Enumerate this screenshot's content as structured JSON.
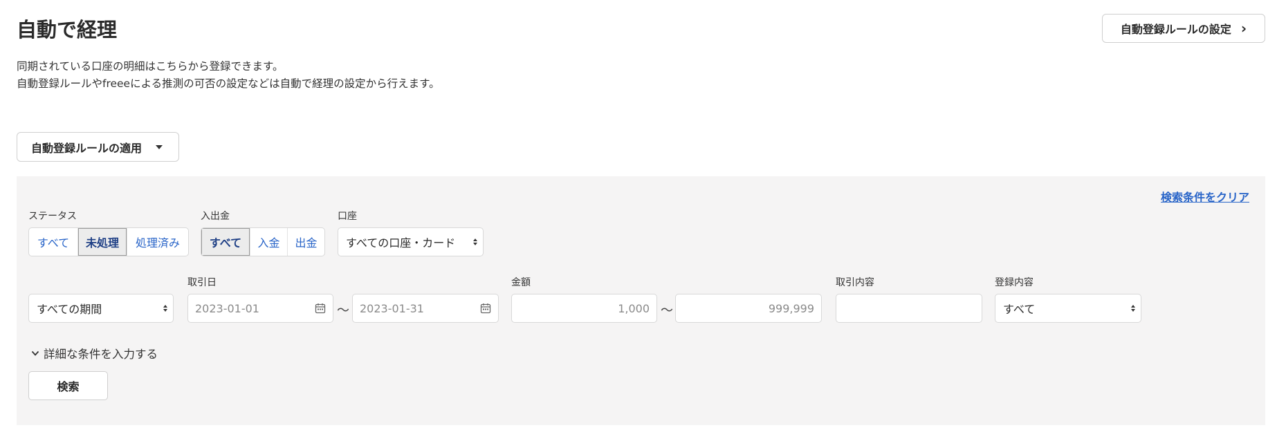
{
  "header": {
    "title": "自動で経理",
    "settings_button": "自動登録ルールの設定"
  },
  "description": [
    "同期されている口座の明細はこちらから登録できます。",
    "自動登録ルールやfreeeによる推測の可否の設定などは自動で経理の設定から行えます。"
  ],
  "apply_button": "自動登録ルールの適用",
  "filters": {
    "clear_link": "検索条件をクリア",
    "status": {
      "label": "ステータス",
      "options": [
        "すべて",
        "未処理",
        "処理済み"
      ],
      "selected": "未処理"
    },
    "inout": {
      "label": "入出金",
      "options": [
        "すべて",
        "入金",
        "出金"
      ],
      "selected": "すべて"
    },
    "account": {
      "label": "口座",
      "value": "すべての口座・カード"
    },
    "period": {
      "value": "すべての期間"
    },
    "date": {
      "label": "取引日",
      "from_placeholder": "2023-01-01",
      "to_placeholder": "2023-01-31",
      "separator": "～"
    },
    "amount": {
      "label": "金額",
      "min_placeholder": "1,000",
      "max_placeholder": "999,999",
      "separator": "～"
    },
    "content": {
      "label": "取引内容",
      "value": ""
    },
    "registered": {
      "label": "登録内容",
      "value": "すべて"
    },
    "detail_toggle": "詳細な条件を入力する",
    "search_button": "検索"
  }
}
